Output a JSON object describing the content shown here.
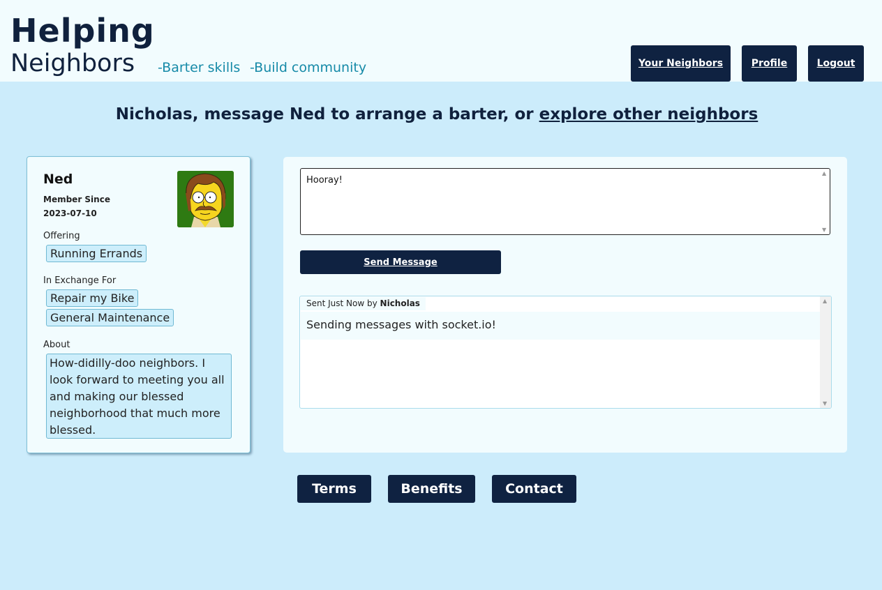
{
  "header": {
    "logo_line1": "Helping",
    "logo_line2": "Neighbors",
    "tagline_1": "-Barter skills",
    "tagline_2": "-Build community",
    "nav": {
      "neighbors": "Your Neighbors",
      "profile": "Profile",
      "logout": "Logout"
    }
  },
  "headline": {
    "prefix": "Nicholas, message Ned to arrange a barter, or ",
    "link": "explore other neighbors"
  },
  "profile": {
    "name": "Ned",
    "member_since_label": "Member Since",
    "member_since_date": "2023-07-10",
    "avatar_icon": "ned-flanders-avatar",
    "offering_label": "Offering",
    "offering": [
      "Running Errands"
    ],
    "exchange_label": "In Exchange For",
    "exchange": [
      "Repair my Bike",
      "General Maintenance"
    ],
    "about_label": "About",
    "about": "How-didilly-doo neighbors. I look forward to meeting you all and making our blessed neighborhood that much more blessed."
  },
  "message": {
    "input_value": "Hooray!",
    "send_label": "Send Message",
    "history": [
      {
        "meta_prefix": "Sent Just Now by ",
        "sender": "Nicholas",
        "text": "Sending messages with socket.io!"
      }
    ]
  },
  "footer": {
    "terms": "Terms",
    "benefits": "Benefits",
    "contact": "Contact"
  },
  "colors": {
    "page_bg": "#ccecfb",
    "header_bg": "#f2fcfe",
    "navy": "#0f2241",
    "teal_text": "#168aa8",
    "chip_bg": "#cdeefb"
  }
}
